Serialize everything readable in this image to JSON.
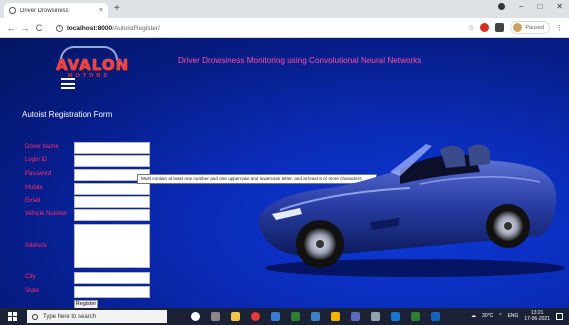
{
  "browser": {
    "tab_title": "Driver Drowsiness",
    "tab_close": "×",
    "new_tab": "+",
    "back": "←",
    "forward": "→",
    "reload": "C",
    "url_host": "localhost:8000",
    "url_path": "/AutoistRegister/",
    "bookmark_star": "☆",
    "profile_status": "Paused",
    "menu": "⋮",
    "window_min": "−",
    "window_max": "□",
    "window_close": "✕"
  },
  "header": {
    "logo_text": "AVALON",
    "logo_subtext": "MOTORS",
    "title": "Driver Drowsiness Monitoring using Convolutional Neural Networks"
  },
  "form": {
    "title": "Autoist Registration Form",
    "fields": [
      {
        "label": "Driver Name"
      },
      {
        "label": "Login ID"
      },
      {
        "label": "Password"
      },
      {
        "label": "Mobile"
      },
      {
        "label": "Email"
      },
      {
        "label": "Vehicle Number"
      },
      {
        "label": "Address"
      },
      {
        "label": "City"
      },
      {
        "label": "State"
      }
    ],
    "tooltip": "Must contain at least one number and one uppercase and lowercase letter, and at least 8 or more characters",
    "submit_label": "Register"
  },
  "taskbar": {
    "search_placeholder": "Type here to search",
    "weather": "30°C",
    "lang": "ENG",
    "time": "13:21",
    "date": "17-06-2021"
  },
  "colors": {
    "page_bg": "#0a2bb5",
    "heading": "#ff4fa0",
    "label": "#ff2d6a",
    "car_body": "#243a9a"
  }
}
